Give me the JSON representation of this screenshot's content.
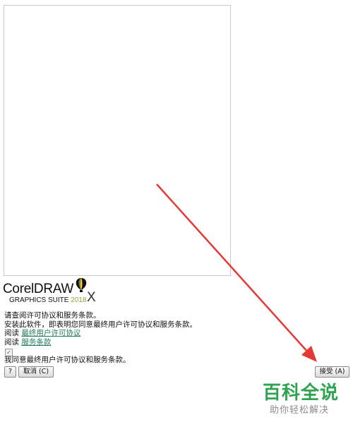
{
  "logo": {
    "product": "CorelDRAW",
    "suite": "GRAPHICS SUITE",
    "year": "2018",
    "close": "X"
  },
  "license": {
    "prompt": "请查阅许可协议和服务条款。",
    "consent_notice": "安装此软件，即表明您同意最终用户许可协议和服务条款。",
    "read_prefix_1": "阅读",
    "eula_link": "最终用户许可协议",
    "read_prefix_2": "阅读",
    "terms_link": "服务条款",
    "agree_label": "我同意最终用户许可协议和服务条款。",
    "agree_checked": true
  },
  "buttons": {
    "help": "?",
    "cancel": "取消 (C)",
    "accept": "接受 (A)"
  },
  "watermark": {
    "title": "百科全说",
    "subtitle": "助你轻松解决"
  },
  "colors": {
    "arrow": "#e53935",
    "link": "#1e7a5c",
    "watermark": "#2fa34f"
  }
}
